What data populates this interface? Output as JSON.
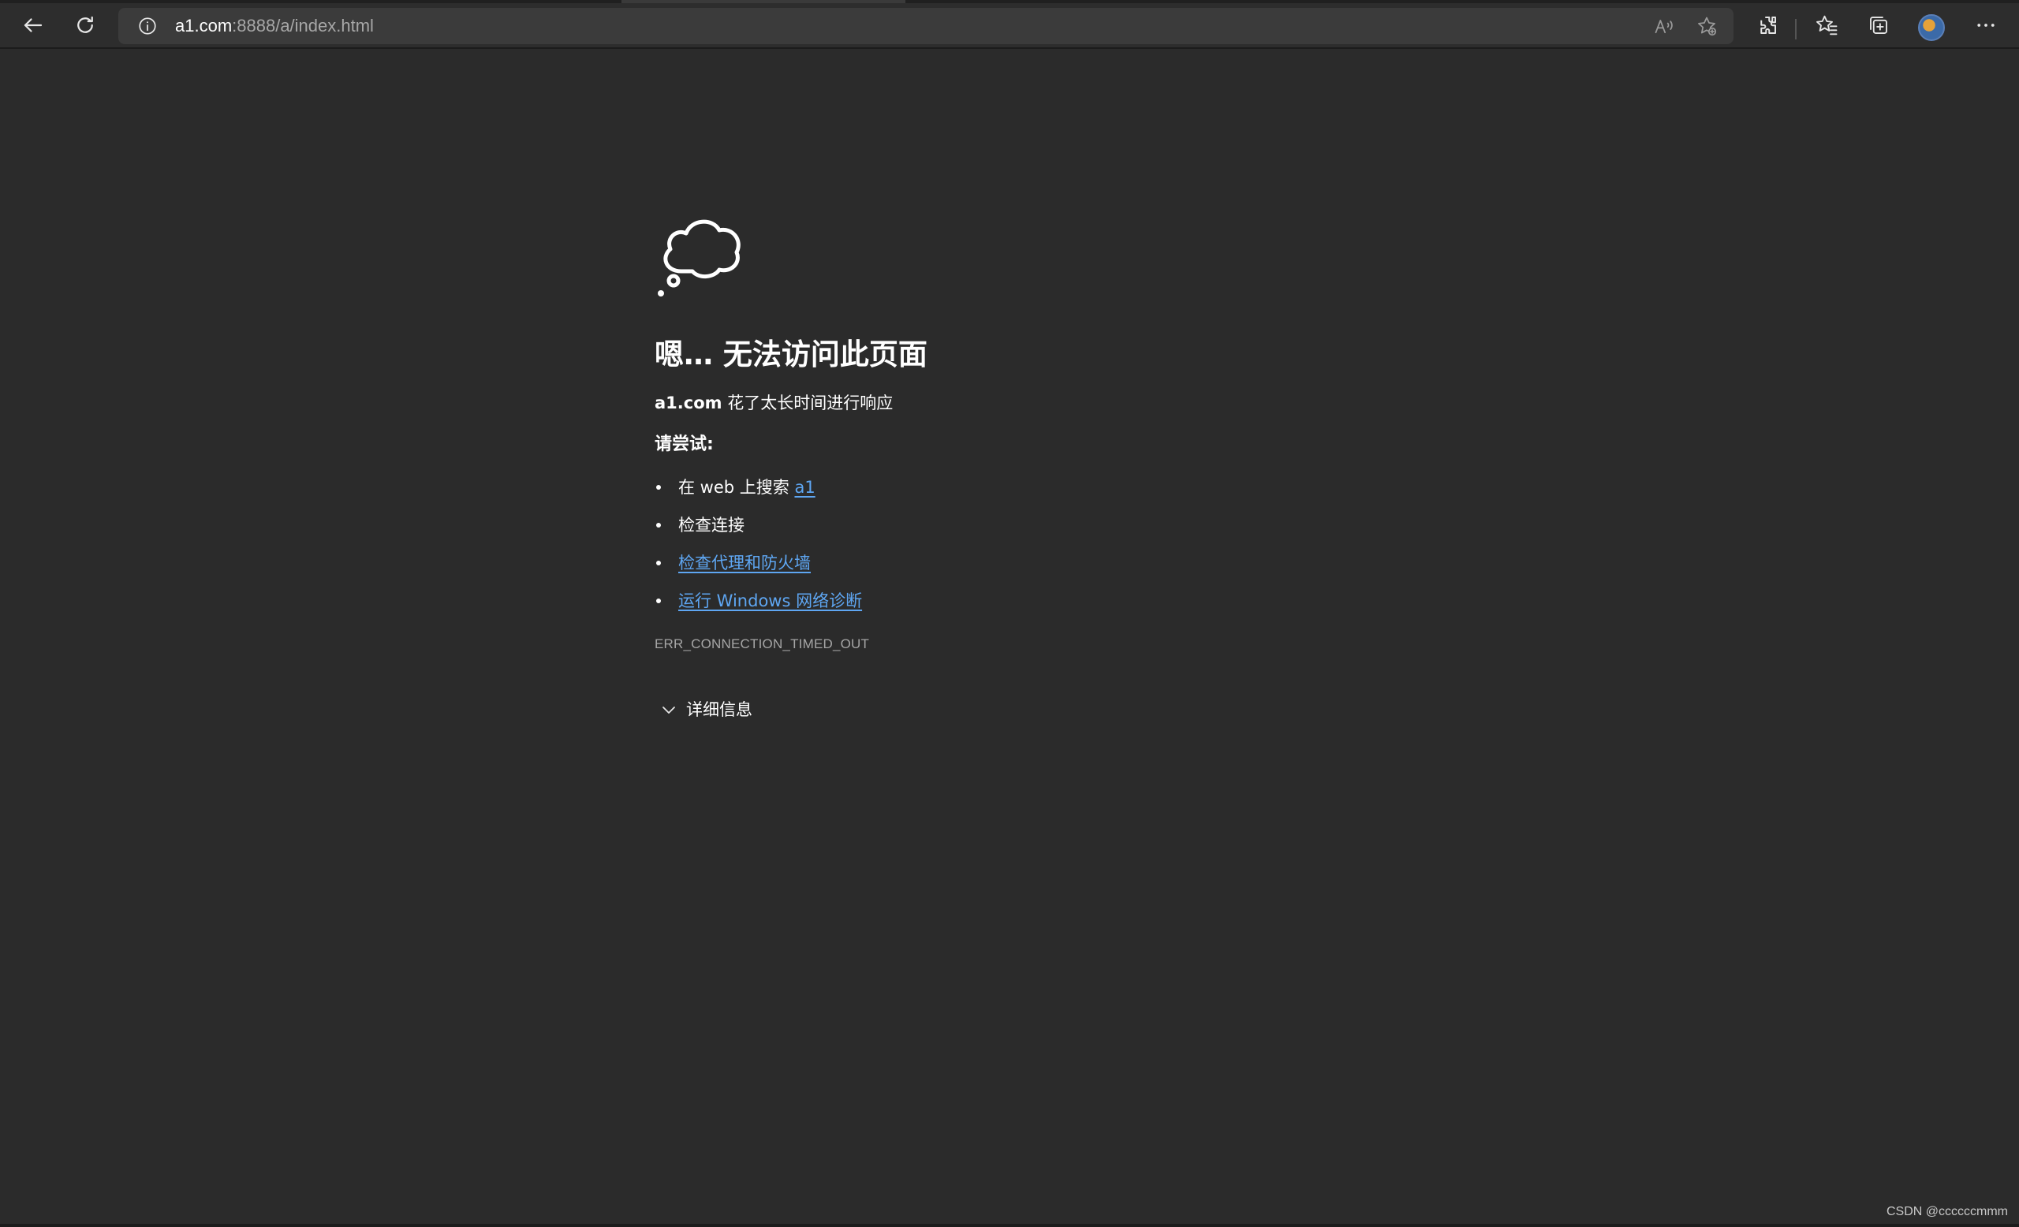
{
  "browser": {
    "address": {
      "host": "a1.com",
      "rest": ":8888/a/index.html"
    },
    "icons": {
      "back": "back-arrow-icon",
      "refresh": "refresh-icon",
      "site_info": "info-icon",
      "read_aloud": "read-aloud-icon",
      "add_favorite": "add-favorite-icon",
      "extensions": "extensions-icon",
      "favorites": "favorites-icon",
      "collections": "collections-icon",
      "profile": "avatar",
      "menu": "more-icon"
    }
  },
  "error_page": {
    "icon": "thought-cloud-icon",
    "title": "嗯… 无法访问此页面",
    "host": "a1.com",
    "message": " 花了太长时间进行响应",
    "try_label": "请尝试:",
    "suggestions": {
      "search_prefix": "在 web 上搜索 ",
      "search_link": "a1",
      "check_connection": "检查连接",
      "check_proxy": "检查代理和防火墙",
      "run_diagnostics": "运行 Windows 网络诊断"
    },
    "error_code": "ERR_CONNECTION_TIMED_OUT",
    "details_label": "详细信息"
  },
  "watermark": "CSDN @ccccccmmm",
  "colors": {
    "background": "#2b2b2b",
    "toolbar": "#2d2d2d",
    "address_bar": "#3b3b3b",
    "link": "#5ea6f2",
    "muted_text": "#a6a6a6"
  }
}
